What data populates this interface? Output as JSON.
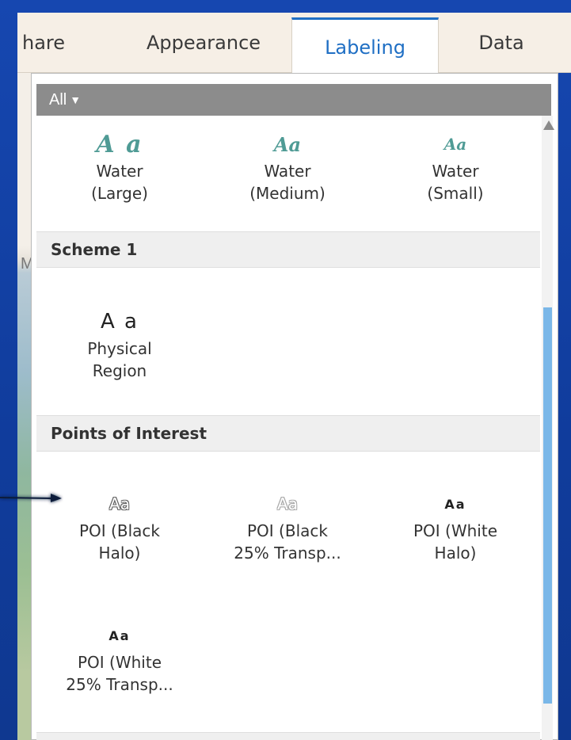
{
  "tabs": [
    {
      "label": "hare"
    },
    {
      "label": "Appearance"
    },
    {
      "label": "Labeling",
      "active": true
    },
    {
      "label": "Data"
    }
  ],
  "filter": {
    "label": "All"
  },
  "map_strip_text": "M",
  "gallery": {
    "top_items": [
      {
        "glyph": "A  a",
        "line1": "Water",
        "line2": "(Large)"
      },
      {
        "glyph": "Aa",
        "line1": "Water",
        "line2": "(Medium)"
      },
      {
        "glyph": "Aa",
        "line1": "Water",
        "line2": "(Small)"
      }
    ],
    "sections": [
      {
        "title": "Scheme 1",
        "items": [
          {
            "glyph": "A  a",
            "line1": "Physical",
            "line2": "Region"
          }
        ]
      },
      {
        "title": "Points of Interest",
        "items": [
          {
            "glyph": "Aa",
            "line1": "POI (Black",
            "line2": "Halo)"
          },
          {
            "glyph": "Aa",
            "line1": "POI (Black",
            "line2": "25% Transp..."
          },
          {
            "glyph": "Aa",
            "line1": "POI (White",
            "line2": "Halo)"
          },
          {
            "glyph": "Aa",
            "line1": "POI (White",
            "line2": "25% Transp..."
          }
        ]
      }
    ]
  },
  "colors": {
    "background": "#123c9a",
    "active_tab": "#1f6fc4",
    "water_label": "#4f9b95",
    "scroll_thumb": "#7ab7e8"
  }
}
